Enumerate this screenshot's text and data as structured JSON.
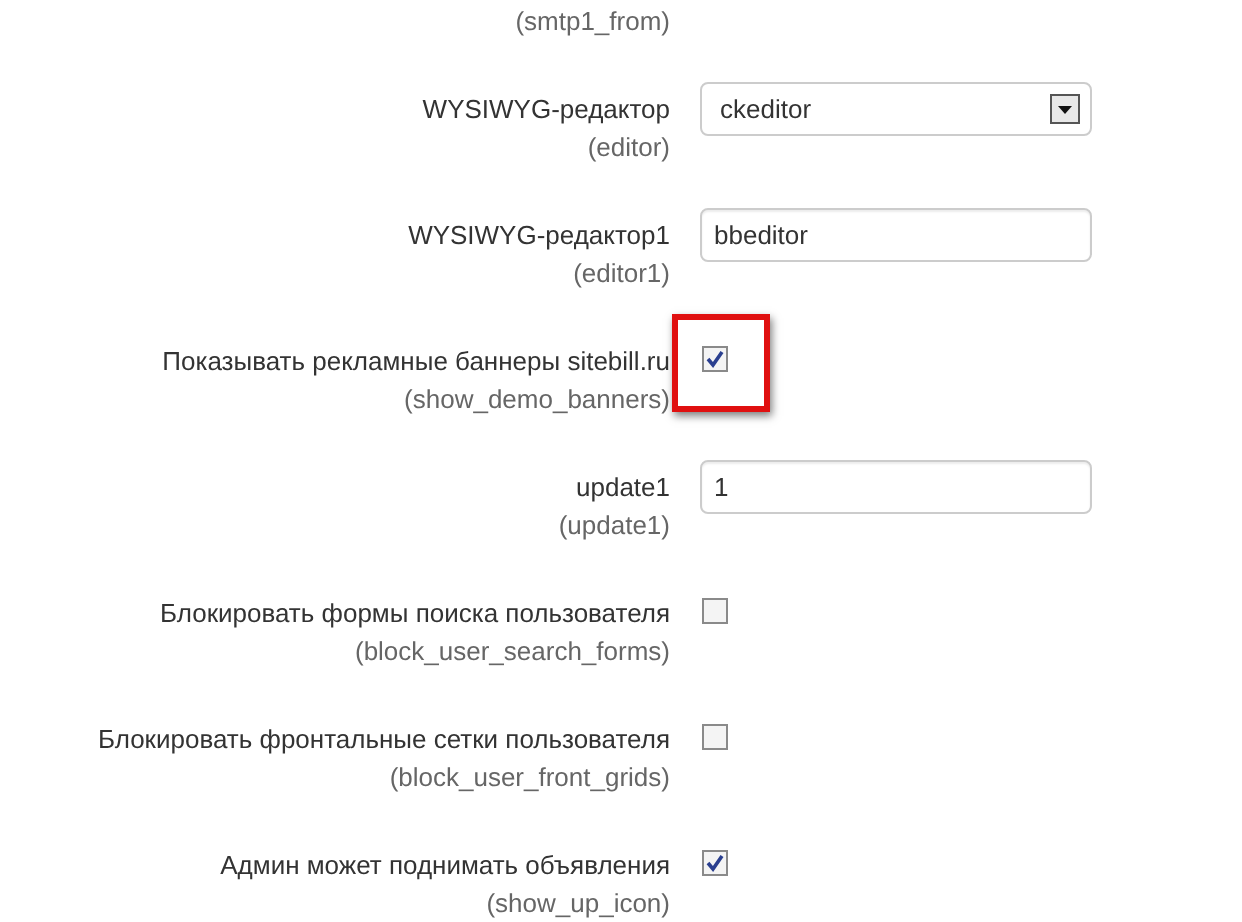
{
  "fields": [
    {
      "kind": "hint-only",
      "hint": "(smtp1_from)"
    },
    {
      "kind": "select",
      "label": "WYSIWYG-редактор",
      "hint": "(editor)",
      "value": "ckeditor"
    },
    {
      "kind": "text",
      "label": "WYSIWYG-редактор1",
      "hint": "(editor1)",
      "value": "bbeditor"
    },
    {
      "kind": "checkbox",
      "label": "Показывать рекламные баннеры sitebill.ru",
      "hint": "(show_demo_banners)",
      "checked": true,
      "highlighted": true
    },
    {
      "kind": "text",
      "label": "update1",
      "hint": "(update1)",
      "value": "1"
    },
    {
      "kind": "checkbox",
      "label": "Блокировать формы поиска пользователя",
      "hint": "(block_user_search_forms)",
      "checked": false,
      "highlighted": false
    },
    {
      "kind": "checkbox",
      "label": "Блокировать фронтальные сетки пользователя",
      "hint": "(block_user_front_grids)",
      "checked": false,
      "highlighted": false
    },
    {
      "kind": "checkbox",
      "label": "Админ может поднимать объявления",
      "hint": "(show_up_icon)",
      "checked": true,
      "highlighted": false
    }
  ]
}
